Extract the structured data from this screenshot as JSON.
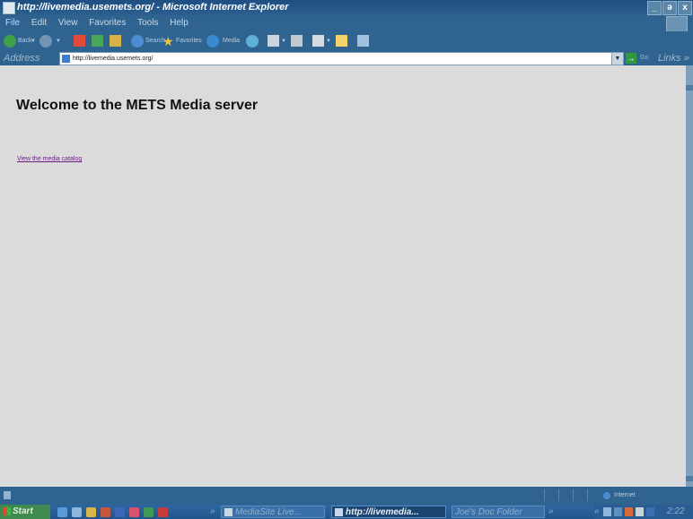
{
  "window": {
    "title": "http://livemedia.usemets.org/ - Microsoft Internet Explorer",
    "controls": [
      "_",
      "ə",
      "x"
    ]
  },
  "menu": [
    "File",
    "Edit",
    "View",
    "Favorites",
    "Tools",
    "Help"
  ],
  "toolbar": {
    "back": "Back",
    "search": "Search",
    "favorites": "Favorites",
    "media": "Media"
  },
  "address": {
    "label": "Address",
    "url": "http://livemedia.usemets.org/",
    "go": "Go",
    "links": "Links »"
  },
  "page": {
    "heading": "Welcome to the METS Media server",
    "link": "View the media catalog"
  },
  "status": {
    "zone": "Internet"
  },
  "taskbar": {
    "start": "Start",
    "chevron": "»",
    "tasks": [
      "MediaSite Live...",
      "http://livemedia...",
      "Joe's Doc Folder"
    ],
    "tray_chevron": "«",
    "clock": "2:22 PM"
  }
}
